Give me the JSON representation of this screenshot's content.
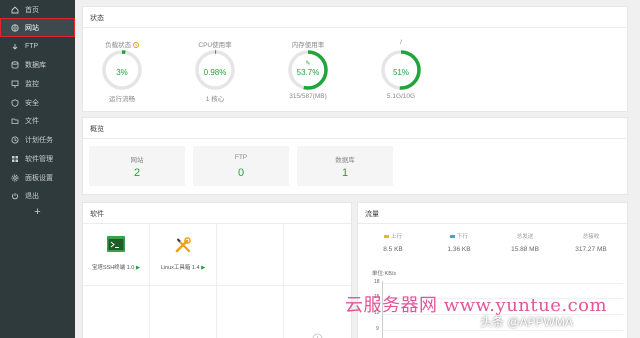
{
  "sidebar": {
    "items": [
      {
        "label": "首页",
        "icon": "home-icon"
      },
      {
        "label": "网站",
        "icon": "globe-icon",
        "active": true
      },
      {
        "label": "FTP",
        "icon": "ftp-icon"
      },
      {
        "label": "数据库",
        "icon": "database-icon"
      },
      {
        "label": "监控",
        "icon": "monitor-icon"
      },
      {
        "label": "安全",
        "icon": "shield-icon"
      },
      {
        "label": "文件",
        "icon": "folder-icon"
      },
      {
        "label": "计划任务",
        "icon": "clock-icon"
      },
      {
        "label": "软件管理",
        "icon": "grid-icon"
      },
      {
        "label": "面板设置",
        "icon": "gear-icon"
      },
      {
        "label": "退出",
        "icon": "logout-icon"
      }
    ],
    "add_label": "+"
  },
  "status": {
    "title": "状态",
    "gauges": [
      {
        "label": "负载状态",
        "value": "3%",
        "sub": "运行流畅",
        "percent": 3
      },
      {
        "label": "CPU使用率",
        "value": "0.98%",
        "sub": "1 核心",
        "percent": 0.98
      },
      {
        "label": "内存使用率",
        "value": "53.7%",
        "sub": "315/587(MB)",
        "percent": 53.7
      },
      {
        "label": "/",
        "value": "51%",
        "sub": "5.1G/10G",
        "percent": 51
      }
    ]
  },
  "overview": {
    "title": "概览",
    "cards": [
      {
        "label": "网站",
        "value": "2"
      },
      {
        "label": "FTP",
        "value": "0"
      },
      {
        "label": "数据库",
        "value": "1"
      }
    ]
  },
  "software": {
    "title": "软件",
    "items": [
      {
        "name": "宝塔SSH终端 1.0",
        "icon": "terminal-icon"
      },
      {
        "name": "Linux工具箱 1.4",
        "icon": "tools-icon"
      }
    ]
  },
  "traffic": {
    "title": "流量",
    "stats": [
      {
        "key": "上行",
        "value": "8.5 KB",
        "color": "#f0b030"
      },
      {
        "key": "下行",
        "value": "1.36 KB",
        "color": "#3fa2e0"
      },
      {
        "key": "总发送",
        "value": "15.88 MB",
        "color": ""
      },
      {
        "key": "总接收",
        "value": "317.27 MB",
        "color": ""
      }
    ],
    "unit": "单位:KB/s",
    "yticks": [
      "18",
      "15",
      "12",
      "9"
    ]
  },
  "colors": {
    "accent": "#20a53a",
    "sidebar": "#2f3a3d",
    "highlight": "#e0252b"
  },
  "watermark": "云服务器网 www.yuntue.com",
  "credit": "头条 @APPWMA"
}
